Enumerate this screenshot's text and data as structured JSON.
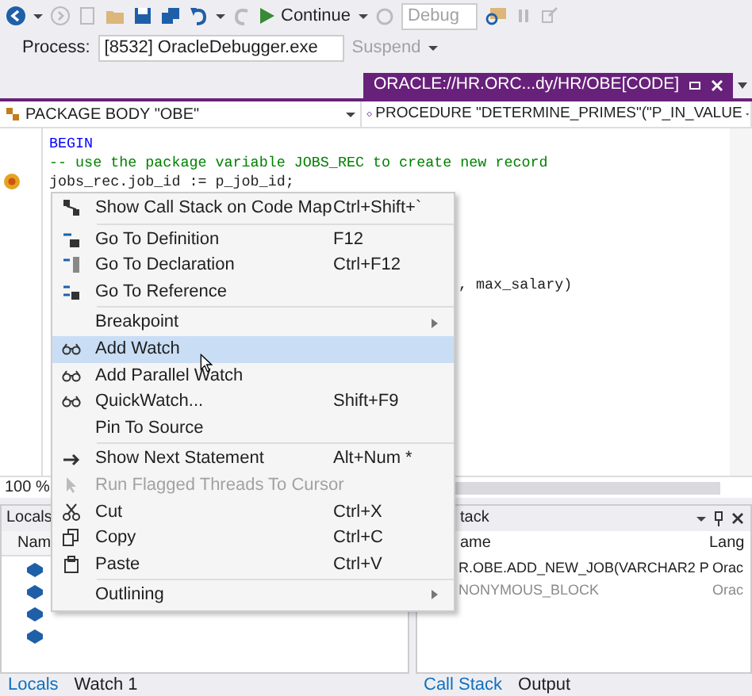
{
  "toolbar": {
    "continue_label": "Continue",
    "configuration": "Debug",
    "configuration_disabled": true,
    "process_label": "Process:",
    "process": "[8532] OracleDebugger.exe",
    "suspend_label": "Suspend",
    "suspend_disabled": true
  },
  "document_tab": {
    "title": "ORACLE://HR.ORC...dy/HR/OBE[CODE]",
    "selected": true
  },
  "navigation": {
    "type_combo": "PACKAGE BODY \"OBE\"",
    "member_combo": "PROCEDURE \"DETERMINE_PRIMES\"(\"P_IN_VALUE"
  },
  "code_lines": [
    {
      "kind": "keyword",
      "text": "BEGIN",
      "breakpoint": false
    },
    {
      "kind": "comment",
      "text": "-- use the package variable JOBS_REC to create new record",
      "breakpoint": false
    },
    {
      "kind": "code",
      "text": "jobs_rec.job_id := p_job_id;",
      "breakpoint": true
    },
    {
      "kind": "code",
      "text": ", max_salary)",
      "breakpoint": false
    }
  ],
  "zoom": "100 %",
  "locals_panel": {
    "title": "Locals",
    "column_1": "Nam"
  },
  "call_stack_panel": {
    "title": "tack",
    "columns": [
      "ame",
      "Lang"
    ],
    "rows": [
      {
        "name": "R.OBE.ADD_NEW_JOB(VARCHAR2 P",
        "language": "Orac",
        "current": true
      },
      {
        "name": "NONYMOUS_BLOCK",
        "language": "Orac",
        "current": false
      }
    ]
  },
  "left_tabs": [
    {
      "label": "Locals",
      "selected": true
    },
    {
      "label": "Watch 1",
      "selected": false
    }
  ],
  "right_tabs": [
    {
      "label": "Call Stack",
      "selected": true
    },
    {
      "label": "Output",
      "selected": false
    }
  ],
  "context_menu": [
    {
      "kind": "item",
      "label": "Show Call Stack on Code Map",
      "shortcut": "Ctrl+Shift+`",
      "disabled": false,
      "selected": false,
      "submenu": false
    },
    {
      "kind": "separator"
    },
    {
      "kind": "item",
      "label": "Go To Definition",
      "shortcut": "F12",
      "disabled": false,
      "selected": false,
      "submenu": false
    },
    {
      "kind": "item",
      "label": "Go To Declaration",
      "shortcut": "Ctrl+F12",
      "disabled": false,
      "selected": false,
      "submenu": false
    },
    {
      "kind": "item",
      "label": "Go To Reference",
      "disabled": false,
      "selected": false,
      "submenu": false
    },
    {
      "kind": "separator"
    },
    {
      "kind": "item",
      "label": "Breakpoint",
      "disabled": false,
      "selected": false,
      "submenu": true
    },
    {
      "kind": "item",
      "label": "Add Watch",
      "disabled": false,
      "selected": true,
      "submenu": false
    },
    {
      "kind": "item",
      "label": "Add Parallel Watch",
      "disabled": false,
      "selected": false,
      "submenu": false
    },
    {
      "kind": "item",
      "label": "QuickWatch...",
      "shortcut": "Shift+F9",
      "disabled": false,
      "selected": false,
      "submenu": false
    },
    {
      "kind": "item",
      "label": "Pin To Source",
      "disabled": false,
      "selected": false,
      "submenu": false
    },
    {
      "kind": "separator"
    },
    {
      "kind": "item",
      "label": "Show Next Statement",
      "shortcut": "Alt+Num *",
      "disabled": false,
      "selected": false,
      "submenu": false
    },
    {
      "kind": "item",
      "label": "Run Flagged Threads To Cursor",
      "disabled": true,
      "selected": false,
      "submenu": false
    },
    {
      "kind": "item",
      "label": "Cut",
      "shortcut": "Ctrl+X",
      "disabled": false,
      "selected": false,
      "submenu": false
    },
    {
      "kind": "item",
      "label": "Copy",
      "shortcut": "Ctrl+C",
      "disabled": false,
      "selected": false,
      "submenu": false
    },
    {
      "kind": "item",
      "label": "Paste",
      "shortcut": "Ctrl+V",
      "disabled": false,
      "selected": false,
      "submenu": false
    },
    {
      "kind": "separator"
    },
    {
      "kind": "item",
      "label": "Outlining",
      "disabled": false,
      "selected": false,
      "submenu": true
    }
  ]
}
